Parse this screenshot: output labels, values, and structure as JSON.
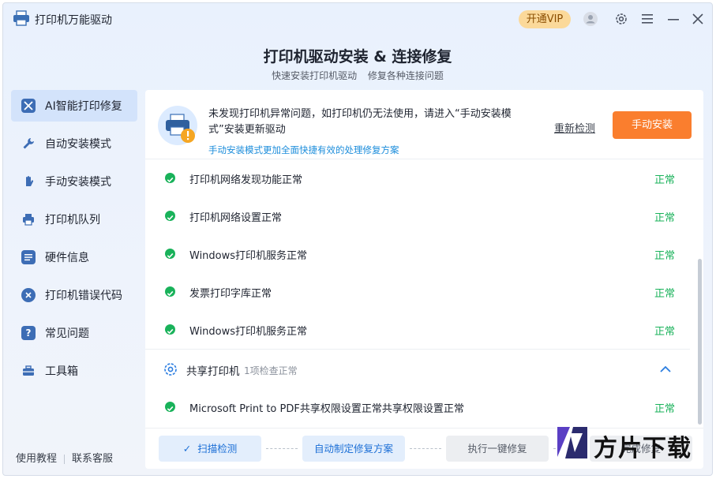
{
  "app": {
    "title": "打印机万能驱动",
    "vip_label": "开通VIP"
  },
  "header": {
    "title": "打印机驱动安装 & 连接修复",
    "subtitle_left": "快速安装打印机驱动",
    "subtitle_right": "修复各种连接问题"
  },
  "sidebar": {
    "items": [
      {
        "label": "AI智能打印修复",
        "icon": "tools-icon",
        "active": true
      },
      {
        "label": "自动安装模式",
        "icon": "wrench-icon",
        "active": false
      },
      {
        "label": "手动安装模式",
        "icon": "hand-icon",
        "active": false
      },
      {
        "label": "打印机队列",
        "icon": "printer-icon",
        "active": false
      },
      {
        "label": "硬件信息",
        "icon": "list-icon",
        "active": false
      },
      {
        "label": "打印机错误代码",
        "icon": "error-icon",
        "active": false
      },
      {
        "label": "常见问题",
        "icon": "question-icon",
        "active": false
      },
      {
        "label": "工具箱",
        "icon": "toolbox-icon",
        "active": false
      }
    ],
    "footer_tutorial": "使用教程",
    "footer_support": "联系客服"
  },
  "notice": {
    "message": "未发现打印机异常问题，如打印机仍无法使用，请进入“手动安装模式”安装更新驱动",
    "link": "手动安装模式更加全面快捷有效的处理修复方案",
    "recheck": "重新检测",
    "manual_install": "手动安装"
  },
  "checks": [
    {
      "label": "打印机网络发现功能正常",
      "status": "正常"
    },
    {
      "label": "打印机网络设置正常",
      "status": "正常"
    },
    {
      "label": "Windows打印机服务正常",
      "status": "正常"
    },
    {
      "label": "发票打印字库正常",
      "status": "正常"
    },
    {
      "label": "Windows打印机服务正常",
      "status": "正常"
    }
  ],
  "shared_section": {
    "title": "共享打印机",
    "count": "1项检查正常",
    "items": [
      {
        "label": "Microsoft Print to PDF共享权限设置正常共享权限设置正常",
        "status": "正常"
      }
    ]
  },
  "steps": {
    "scan": "扫描检测",
    "plan": "自动制定修复方案",
    "repair": "执行一键修复",
    "done": "完成修复"
  },
  "watermark": {
    "text": "方片下载"
  },
  "colors": {
    "accent_blue": "#1c6fd6",
    "ok_green": "#19b25a",
    "orange": "#fa7e2e",
    "vip_gold": "#fbd99a"
  }
}
